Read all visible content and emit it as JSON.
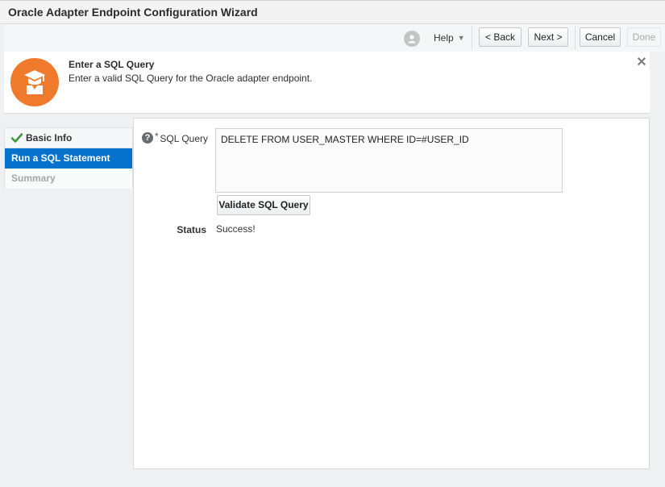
{
  "window": {
    "title": "Oracle Adapter Endpoint Configuration Wizard"
  },
  "toolbar": {
    "help_icon": "user-badge-icon",
    "help_label": "Help",
    "back_label": "< Back",
    "next_label": "Next >",
    "cancel_label": "Cancel",
    "done_label": "Done"
  },
  "header": {
    "icon": "graduate-icon",
    "title": "Enter a SQL Query",
    "subtitle": "Enter a valid SQL Query for the Oracle adapter endpoint.",
    "close_icon": "close-icon"
  },
  "steps": [
    {
      "label": "Basic Info",
      "state": "completed"
    },
    {
      "label": "Run a SQL Statement",
      "state": "active"
    },
    {
      "label": "Summary",
      "state": "pending"
    }
  ],
  "form": {
    "help_glyph": "?",
    "required_mark": "*",
    "query_label": "SQL Query",
    "query_value": "DELETE FROM USER_MASTER WHERE ID=#USER_ID",
    "validate_label": "Validate SQL Query",
    "status_label": "Status",
    "status_value": "Success!"
  },
  "colors": {
    "accent": "#0572ce",
    "badge": "#f07a2b",
    "check": "#3a9a3a"
  }
}
